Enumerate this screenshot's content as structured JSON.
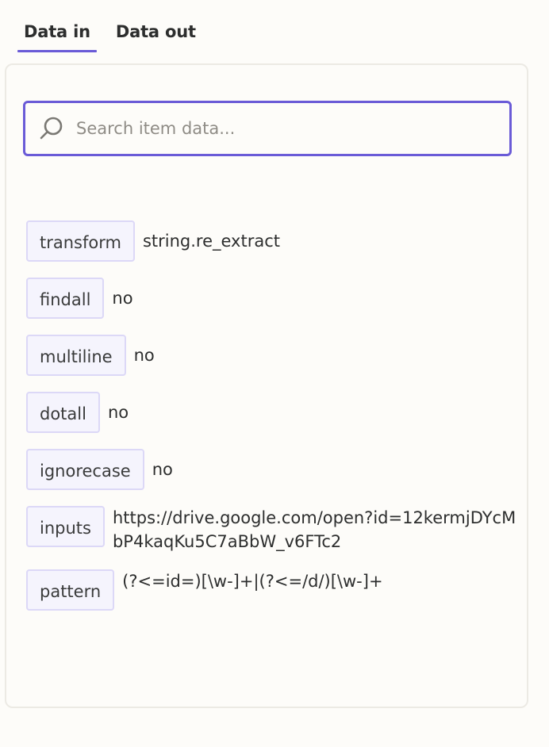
{
  "tabs": [
    {
      "label": "Data in",
      "active": true
    },
    {
      "label": "Data out",
      "active": false
    }
  ],
  "search": {
    "placeholder": "Search item data...",
    "value": "",
    "icon": "search-icon"
  },
  "fields": [
    {
      "key": "transform",
      "value": "string.re_extract"
    },
    {
      "key": "findall",
      "value": "no"
    },
    {
      "key": "multiline",
      "value": "no"
    },
    {
      "key": "dotall",
      "value": "no"
    },
    {
      "key": "ignorecase",
      "value": "no"
    },
    {
      "key": "inputs",
      "value": "https://drive.google.com/open?id=12kermjDYcMbP4kaqKu5C7aBbW_v6FTc2"
    },
    {
      "key": "pattern",
      "value": "(?<=id=)[\\w-]+|(?<=/d/)[\\w-]+"
    }
  ],
  "colors": {
    "accent": "#6a5bd7",
    "key_bg": "#f5f4fd",
    "key_border": "#dcd8f7"
  }
}
